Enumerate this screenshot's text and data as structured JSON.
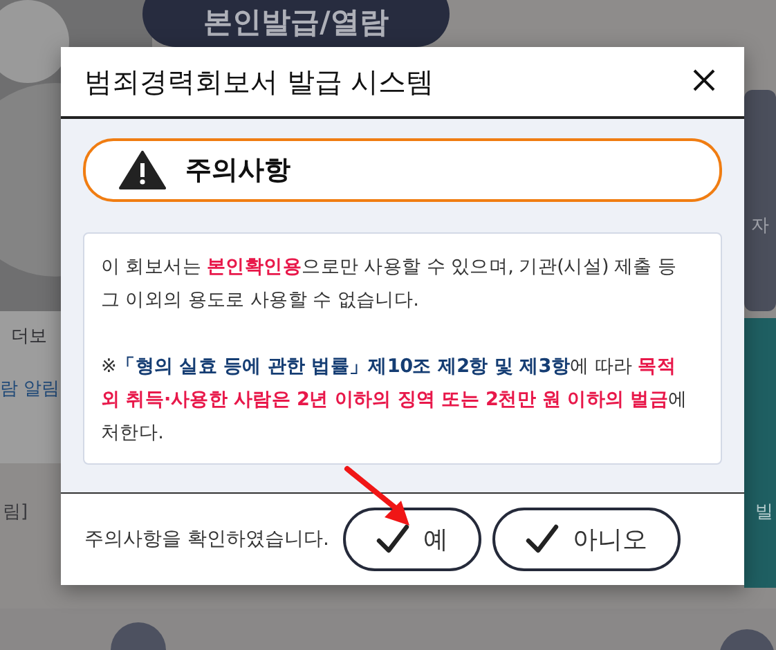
{
  "background": {
    "pill": "본인발급/열람",
    "fragments": [
      "자",
      "더보",
      "람 알림",
      "림]",
      "빌"
    ]
  },
  "dialog": {
    "title": "범죄경력회보서 발급 시스템",
    "notice_heading": "주의사항",
    "paragraphs": [
      [
        {
          "text": "이 회보서는 ",
          "kind": "plain"
        },
        {
          "text": "본인확인용",
          "kind": "warning"
        },
        {
          "text": "으로만 사용할 수 있으며, 기관(시설) 제출 등 그 이외의 용도로 사용할 수 없습니다.",
          "kind": "plain"
        }
      ],
      [
        {
          "text": "※",
          "kind": "plain"
        },
        {
          "text": "「형의 실효 등에 관한 법률」제10조 제2항 및 제3항",
          "kind": "law"
        },
        {
          "text": "에 따라 ",
          "kind": "plain"
        },
        {
          "text": "목적 외 취득·사용한 사람은 2년 이하의 징역 또는 2천만 원 이하의 벌금",
          "kind": "warning"
        },
        {
          "text": "에 처한다.",
          "kind": "plain"
        }
      ]
    ],
    "confirm_text": "주의사항을 확인하였습니다.",
    "buttons": [
      "예",
      "아니오"
    ]
  }
}
